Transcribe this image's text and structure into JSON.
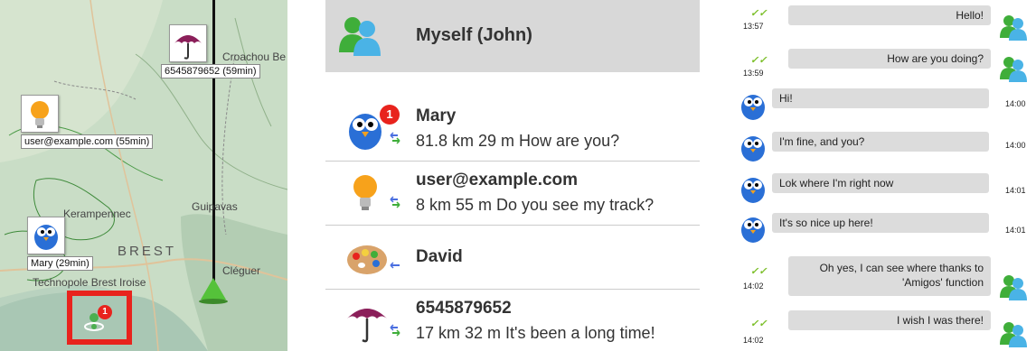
{
  "map": {
    "labels": {
      "croachou": "Croachou Be",
      "kerampennec": "Kerampennec",
      "guipavas": "Guipavas",
      "brest": "BREST",
      "cleguer": "Cléguer",
      "technopole": "Technopole Brest Iroise"
    },
    "markers": [
      {
        "icon": "umbrella-icon",
        "caption": "6545879652 (59min)"
      },
      {
        "icon": "lightbulb-icon",
        "caption": "user@example.com (55min)"
      },
      {
        "icon": "bird-icon",
        "caption": "Mary (29min)"
      }
    ],
    "self_badge": "1",
    "colors": {
      "track": "#111111",
      "highlight": "#e8231d",
      "land": "#b9d2bf"
    }
  },
  "contacts": {
    "header": {
      "title": "Myself (John)",
      "icon": "messenger-people-icon"
    },
    "list": [
      {
        "name": "Mary",
        "info": "81.8 km  29 m  How are you?",
        "icon": "bird-icon",
        "badge": "1"
      },
      {
        "name": "user@example.com",
        "info": "8 km  55 m  Do you see my track?",
        "icon": "lightbulb-icon"
      },
      {
        "name": "David",
        "info": "",
        "icon": "palette-icon"
      },
      {
        "name": "6545879652",
        "info": "17 km  32 m  It's been a long time!",
        "icon": "umbrella-icon"
      }
    ]
  },
  "chat": {
    "messages": [
      {
        "dir": "out",
        "text": "Hello!",
        "time": "13:57"
      },
      {
        "dir": "out",
        "text": "How are you doing?",
        "time": "13:59"
      },
      {
        "dir": "in",
        "text": "Hi!",
        "time": "14:00"
      },
      {
        "dir": "in",
        "text": "I'm fine, and you?",
        "time": "14:00"
      },
      {
        "dir": "in",
        "text": "Lok where I'm right now",
        "time": "14:01"
      },
      {
        "dir": "in",
        "text": "It's so nice up here!",
        "time": "14:01"
      },
      {
        "dir": "out",
        "text": "Oh yes, I can see where thanks to 'Amigos' function",
        "time": "14:02"
      },
      {
        "dir": "out",
        "text": "I wish I was there!",
        "time": "14:02"
      }
    ]
  }
}
